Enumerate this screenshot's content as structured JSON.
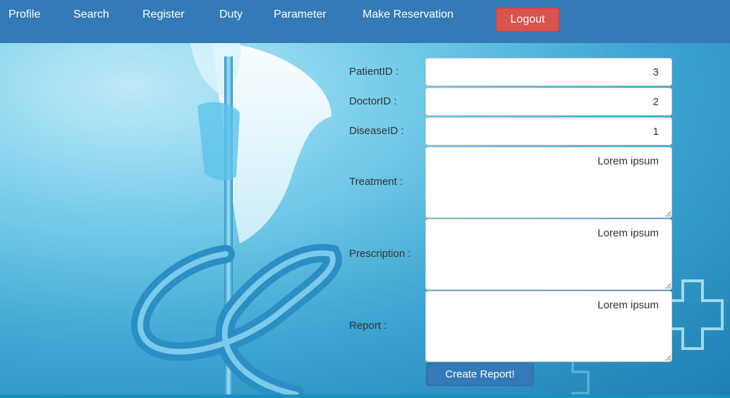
{
  "nav": {
    "items": [
      "Profile",
      "Search",
      "Register",
      "Duty",
      "Parameter",
      "Make Reservation"
    ],
    "logout_label": "Logout"
  },
  "form": {
    "patient_id_label": "PatientID :",
    "patient_id_value": "3",
    "doctor_id_label": "DoctorID :",
    "doctor_id_value": "2",
    "disease_id_label": "DiseaseID :",
    "disease_id_value": "1",
    "treatment_label": "Treatment :",
    "treatment_value": "Lorem ipsum",
    "prescription_label": "Prescription :",
    "prescription_value": "Lorem ipsum",
    "report_label": "Report :",
    "report_value": "Lorem ipsum",
    "submit_label": "Create Report!"
  },
  "colors": {
    "navbar": "#337ab7",
    "logout": "#d9534f",
    "primary_button": "#337ab7"
  },
  "background_image": "medical caduceus with angel wings and cross symbols"
}
